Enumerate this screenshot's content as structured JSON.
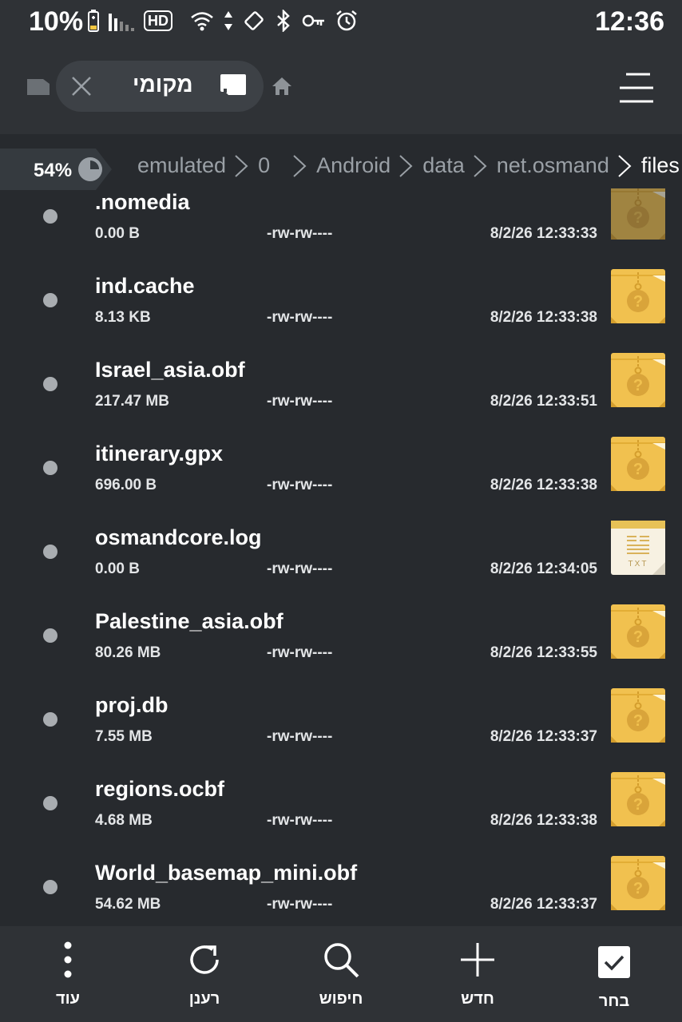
{
  "status_bar": {
    "battery_percent": "10%",
    "network_badge": "HD",
    "time": "12:36"
  },
  "app_bar": {
    "tab_label": "מקומי",
    "icons": [
      "sd-card-icon",
      "close-icon",
      "sd-card-icon",
      "home-icon",
      "menu-icon"
    ]
  },
  "storage": {
    "used_percent_label": "54%",
    "used_fraction": 0.54
  },
  "breadcrumb": [
    {
      "label": "emulated"
    },
    {
      "label": "0"
    },
    {
      "label": "Android"
    },
    {
      "label": "data"
    },
    {
      "label": "net.osmand"
    },
    {
      "label": "files"
    }
  ],
  "files": [
    {
      "name": ".nomedia",
      "size": "0.00 B",
      "permissions": "-rw-rw----",
      "modified": "8/2/26 12:33:33",
      "icon": "unknown-file-icon"
    },
    {
      "name": "ind.cache",
      "size": "8.13 KB",
      "permissions": "-rw-rw----",
      "modified": "8/2/26 12:33:38",
      "icon": "unknown-file-icon"
    },
    {
      "name": "Israel_asia.obf",
      "size": "217.47 MB",
      "permissions": "-rw-rw----",
      "modified": "8/2/26 12:33:51",
      "icon": "unknown-file-icon"
    },
    {
      "name": "itinerary.gpx",
      "size": "696.00 B",
      "permissions": "-rw-rw----",
      "modified": "8/2/26 12:33:38",
      "icon": "unknown-file-icon"
    },
    {
      "name": "osmandcore.log",
      "size": "0.00 B",
      "permissions": "-rw-rw----",
      "modified": "8/2/26 12:34:05",
      "icon": "text-file-icon",
      "icon_text": "TXT"
    },
    {
      "name": "Palestine_asia.obf",
      "size": "80.26 MB",
      "permissions": "-rw-rw----",
      "modified": "8/2/26 12:33:55",
      "icon": "unknown-file-icon"
    },
    {
      "name": "proj.db",
      "size": "7.55 MB",
      "permissions": "-rw-rw----",
      "modified": "8/2/26 12:33:37",
      "icon": "unknown-file-icon"
    },
    {
      "name": "regions.ocbf",
      "size": "4.68 MB",
      "permissions": "-rw-rw----",
      "modified": "8/2/26 12:33:38",
      "icon": "unknown-file-icon"
    },
    {
      "name": "World_basemap_mini.obf",
      "size": "54.62 MB",
      "permissions": "-rw-rw----",
      "modified": "8/2/26 12:33:37",
      "icon": "unknown-file-icon"
    }
  ],
  "bottom_bar": {
    "more_label": "עוד",
    "refresh_label": "רענן",
    "search_label": "חיפוש",
    "new_label": "חדש",
    "select_label": "בחר"
  },
  "colors": {
    "background": "#272a2e",
    "bars": "#2f3236",
    "file_icon": "#f1c14f",
    "text_secondary": "#9aa0a6"
  }
}
